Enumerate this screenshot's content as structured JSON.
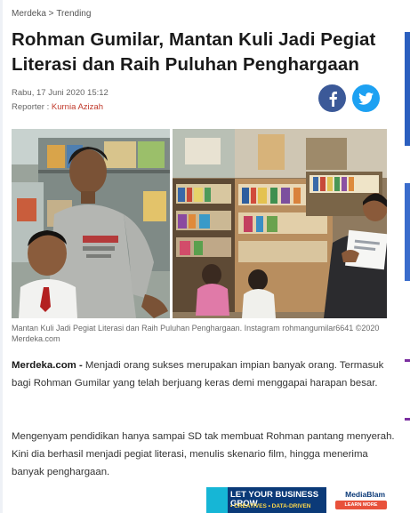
{
  "breadcrumb": {
    "site": "Merdeka",
    "separator": " > ",
    "section": "Trending"
  },
  "article": {
    "title": "Rohman Gumilar, Mantan Kuli Jadi Pegiat Literasi dan Raih Puluhan Penghargaan",
    "date": "Rabu, 17 Juni 2020 15:12",
    "reporter_label": "Reporter : ",
    "reporter_name": "Kurnia Azizah",
    "caption": "Mantan Kuli Jadi Pegiat Literasi dan Raih Puluhan Penghargaan. Instagram rohmangumilar6641 ©2020 Merdeka.com",
    "source": "Merdeka.com -",
    "paragraph1": " Menjadi orang sukses merupakan impian banyak orang. Termasuk bagi Rohman Gumilar yang telah berjuang keras demi menggapai harapan besar.",
    "paragraph2": "Mengenyam pendidikan hanya sampai SD tak membuat Rohman pantang menyerah. Kini dia berhasil menjadi pegiat literasi, menulis skenario film, hingga menerima banyak penghargaan."
  },
  "share": {
    "facebook_icon": "facebook-icon",
    "twitter_icon": "twitter-icon"
  },
  "ad": {
    "headline": "LET YOUR BUSINESS GROW",
    "sub": "• CREATIVES • DATA-DRIVEN",
    "brand": "MediaBlam",
    "cta": "LEARN MORE"
  },
  "colors": {
    "facebook": "#3b5998",
    "twitter": "#1da1f2",
    "reporter": "#c0392b",
    "ad_bg": "#0b3a78"
  }
}
